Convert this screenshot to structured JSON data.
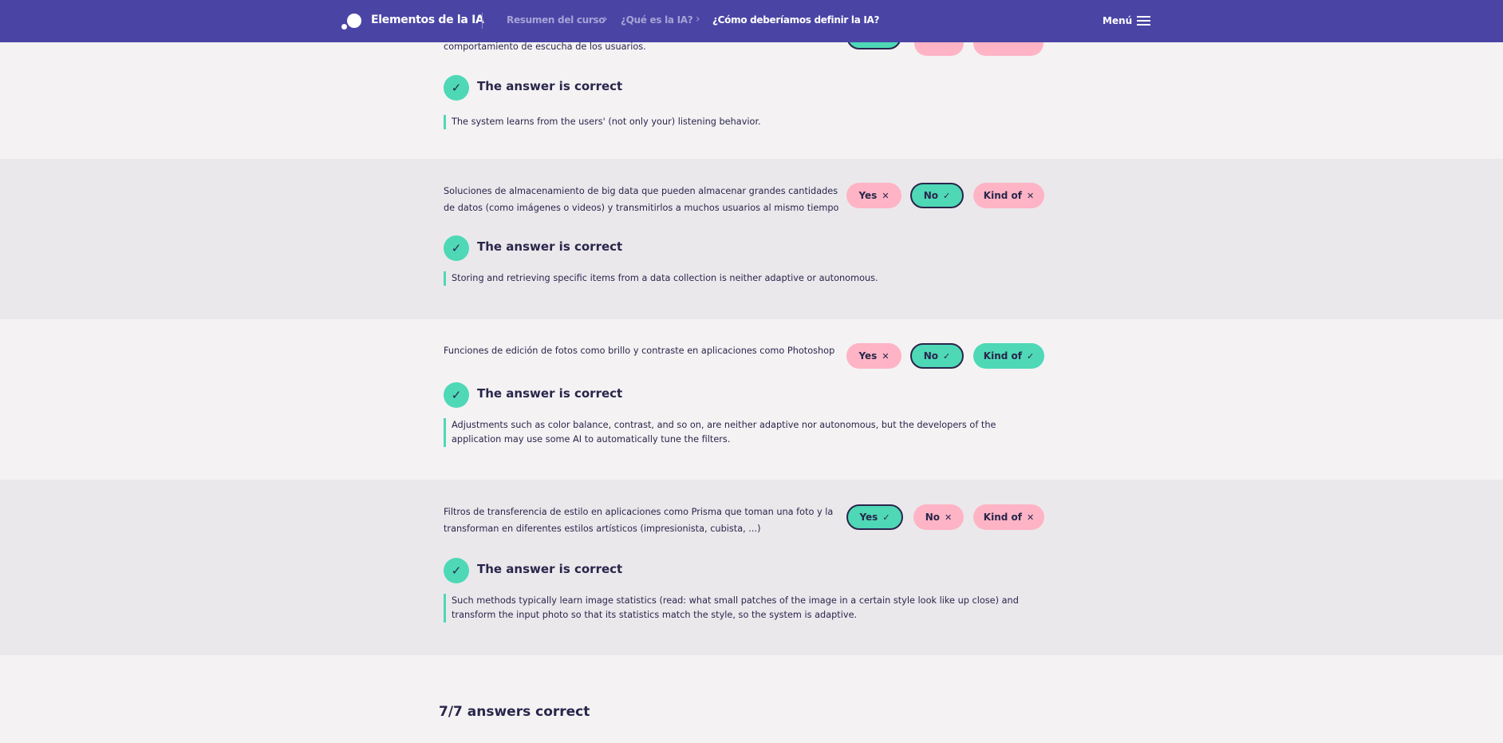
{
  "header": {
    "brand": "Elementos de la IA",
    "breadcrumbs": [
      "Resumen del curso",
      "¿Qué es la IA?",
      "¿Cómo deberíamos definir la IA?"
    ],
    "menu_label": "Menú",
    "background": "#4a45a5"
  },
  "colors": {
    "correct": "#4ed8b6",
    "incorrect": "#feb4c5",
    "text": "#29264b"
  },
  "partial_item": {
    "question_tail": "comportamiento de escucha de los usuarios.",
    "result": "The answer is correct",
    "explanation": "The system learns from the users' (not only your) listening behavior."
  },
  "items": [
    {
      "question": "Soluciones de almacenamiento de big data que pueden almacenar grandes cantidades de datos (como imágenes o videos) y transmitirlos a muchos usuarios al mismo tiempo",
      "options": [
        {
          "label": "Yes",
          "mark": "✕",
          "state": "incorrect",
          "selected": false
        },
        {
          "label": "No",
          "mark": "✓",
          "state": "correct",
          "selected": true
        },
        {
          "label": "Kind of",
          "mark": "✕",
          "state": "incorrect",
          "selected": false
        }
      ],
      "result": "The answer is correct",
      "explanation": "Storing and retrieving specific items from a data collection is neither adaptive or autonomous."
    },
    {
      "question": "Funciones de edición de fotos como brillo y contraste en aplicaciones como Photoshop",
      "options": [
        {
          "label": "Yes",
          "mark": "✕",
          "state": "incorrect",
          "selected": false
        },
        {
          "label": "No",
          "mark": "✓",
          "state": "correct",
          "selected": true
        },
        {
          "label": "Kind of",
          "mark": "✓",
          "state": "correct",
          "selected": false
        }
      ],
      "result": "The answer is correct",
      "explanation": "Adjustments such as color balance, contrast, and so on, are neither adaptive nor autonomous, but the developers of the application may use some AI to automatically tune the filters."
    },
    {
      "question": "Filtros de transferencia de estilo en aplicaciones como Prisma que toman una foto y la transforman en diferentes estilos artísticos (impresionista, cubista, ...)",
      "options": [
        {
          "label": "Yes",
          "mark": "✓",
          "state": "correct",
          "selected": true
        },
        {
          "label": "No",
          "mark": "✕",
          "state": "incorrect",
          "selected": false
        },
        {
          "label": "Kind of",
          "mark": "✕",
          "state": "incorrect",
          "selected": false
        }
      ],
      "result": "The answer is correct",
      "explanation": "Such methods typically learn image statistics (read: what small patches of the image in a certain style look like up close) and transform the input photo so that its statistics match the style, so the system is adaptive."
    }
  ],
  "score_text": "7/7 answers correct"
}
